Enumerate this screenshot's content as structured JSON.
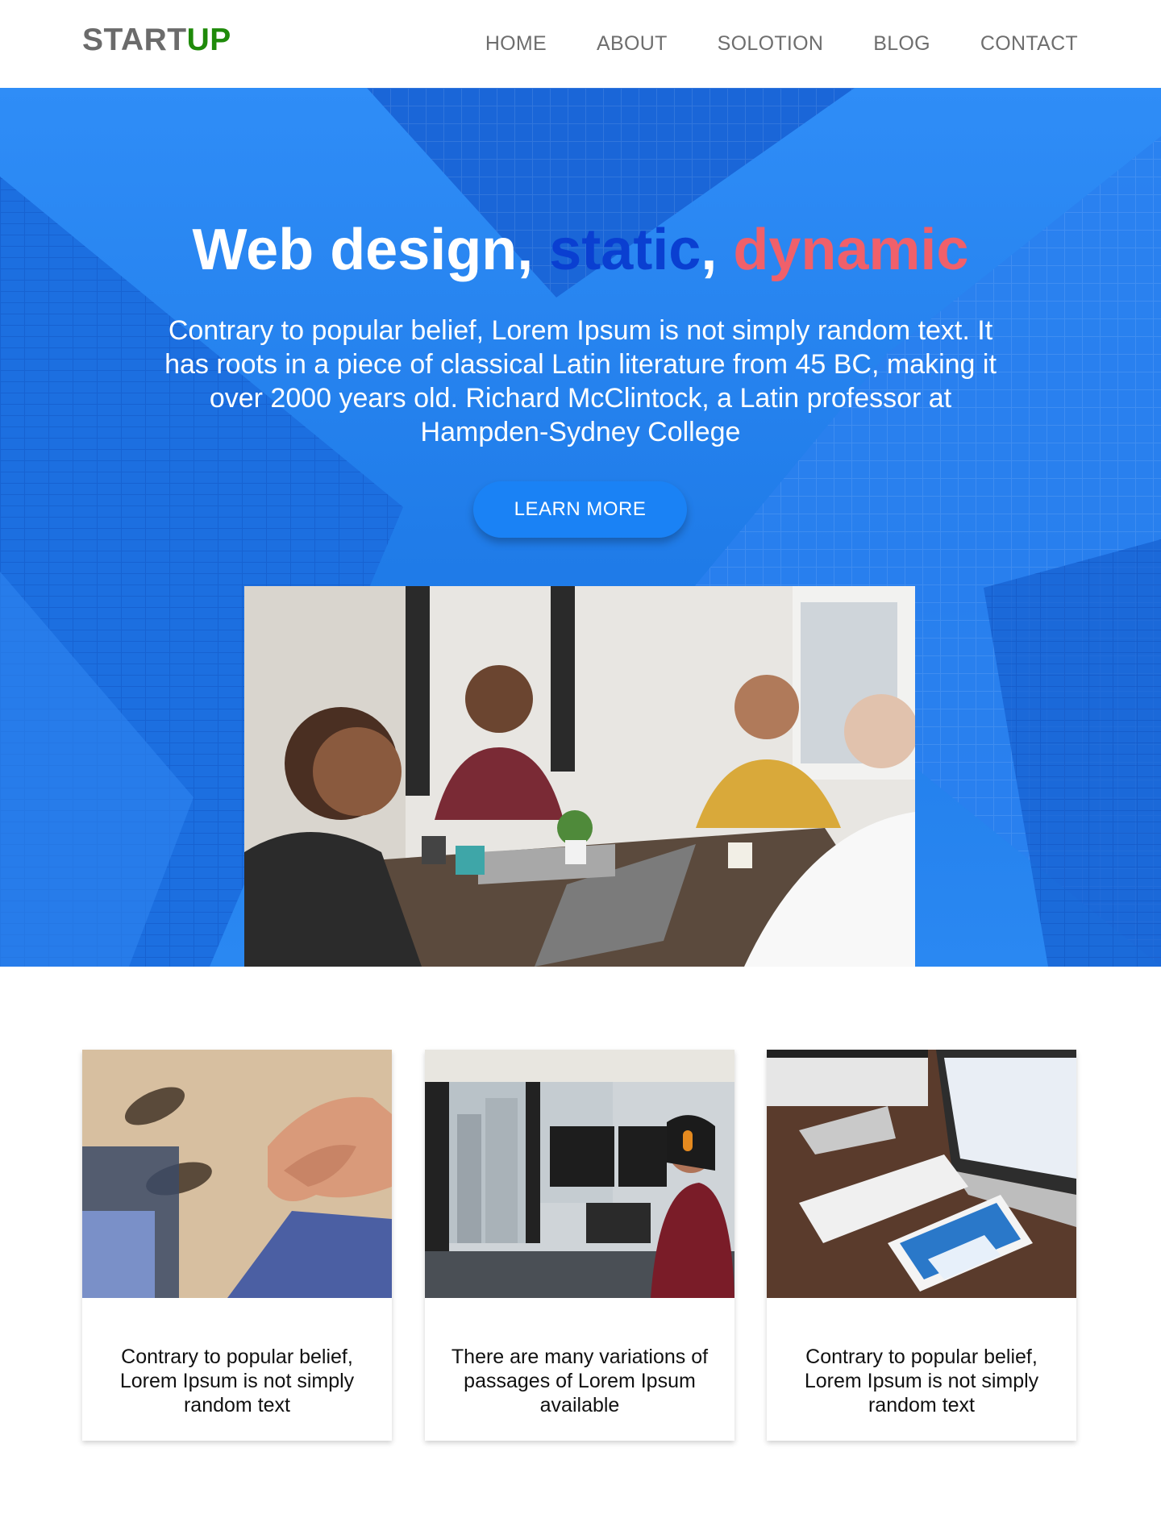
{
  "header": {
    "logo_part1": "START",
    "logo_part2": "UP",
    "nav": [
      "HOME",
      "ABOUT",
      "SOLOTION",
      "BLOG",
      "CONTACT"
    ]
  },
  "hero": {
    "title_part1": "Web design, ",
    "title_static": "static",
    "title_sep": ", ",
    "title_dynamic": "dynamic",
    "text": "Contrary to popular belief, Lorem Ipsum is not simply random text. It has roots in a piece of classical Latin literature from 45 BC, making it over 2000 years old. Richard McClintock, a Latin professor at Hampden-Sydney College",
    "button": "LEARN MORE"
  },
  "cards": [
    {
      "text": "Contrary to popular belief, Lorem Ipsum is not simply random text"
    },
    {
      "text": "There are many variations of passages of Lorem Ipsum available"
    },
    {
      "text": "Contrary to popular belief, Lorem Ipsum is not simply random text"
    }
  ],
  "colors": {
    "brand_gray": "#6b6b6b",
    "brand_green": "#1f8a0a",
    "hero_blue": "#2a88f2",
    "accent_static": "#0a3fd1",
    "accent_dynamic": "#f0606a",
    "button_blue": "#1a82f5"
  }
}
